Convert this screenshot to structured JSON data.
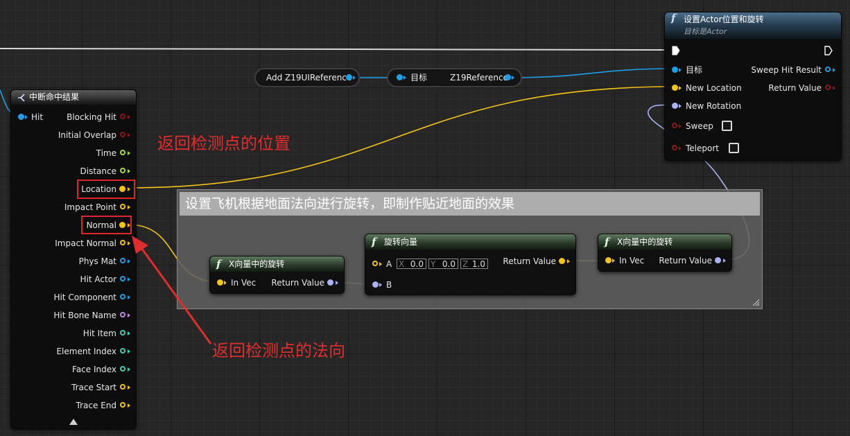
{
  "nodes": {
    "break_hit": {
      "title": "中断命中结果",
      "input": "Hit",
      "outputs": [
        "Blocking Hit",
        "Initial Overlap",
        "Time",
        "Distance",
        "Location",
        "Impact Point",
        "Normal",
        "Impact Normal",
        "Phys Mat",
        "Hit Actor",
        "Hit Component",
        "Hit Bone Name",
        "Hit Item",
        "Element Index",
        "Face Index",
        "Trace Start",
        "Trace End"
      ],
      "output_colors": [
        "#8a1a1a",
        "#8a1a1a",
        "#a3e03a",
        "#a3e03a",
        "#f5c418",
        "#f5c418",
        "#f5c418",
        "#f5c418",
        "#1ea0e8",
        "#1ea0e8",
        "#1ea0e8",
        "#c58ae6",
        "#3ed0b4",
        "#3ed0b4",
        "#3ed0b4",
        "#f5c418",
        "#f5c418"
      ]
    },
    "set_actor_loc_rot": {
      "title": "设置Actor位置和旋转",
      "subtitle_prefix": "目标是",
      "subtitle_target": "Actor",
      "inputs": [
        "目标",
        "New Location",
        "New Rotation",
        "Sweep",
        "Teleport"
      ],
      "input_colors": [
        "#1ea0e8",
        "#f5c418",
        "#a8b2f5",
        "#8a1a1a",
        "#8a1a1a"
      ],
      "outputs": [
        "Sweep Hit Result",
        "Return Value"
      ],
      "output_colors": [
        "#1ea0e8",
        "#8a1a1a"
      ]
    },
    "add_ref": {
      "label": "Add Z19UIReference"
    },
    "get_ref": {
      "target_label": "目标",
      "output_label": "Z19Reference"
    },
    "vec_rot_1": {
      "title": "X向量中的旋转",
      "input": "In Vec",
      "output": "Return Value"
    },
    "rotate_vector": {
      "title": "旋转向量",
      "input_a": "A",
      "a_x_axis": "X",
      "a_x": "0.0",
      "a_y_axis": "Y",
      "a_y": "0.0",
      "a_z_axis": "Z",
      "a_z": "1.0",
      "input_b": "B",
      "output": "Return Value"
    },
    "vec_rot_2": {
      "title": "X向量中的旋转",
      "input": "In Vec",
      "output": "Return Value"
    }
  },
  "comment": {
    "text": "设置飞机根据地面法向进行旋转，即制作贴近地面的效果"
  },
  "annotations": {
    "location_note": "返回检测点的位置",
    "normal_note": "返回检测点的法向"
  },
  "colors": {
    "exec": "#ffffff",
    "object": "#1ea0e8",
    "vector": "#f5c418",
    "rotator": "#a8b2f5",
    "annotation": "#e12d2d"
  }
}
